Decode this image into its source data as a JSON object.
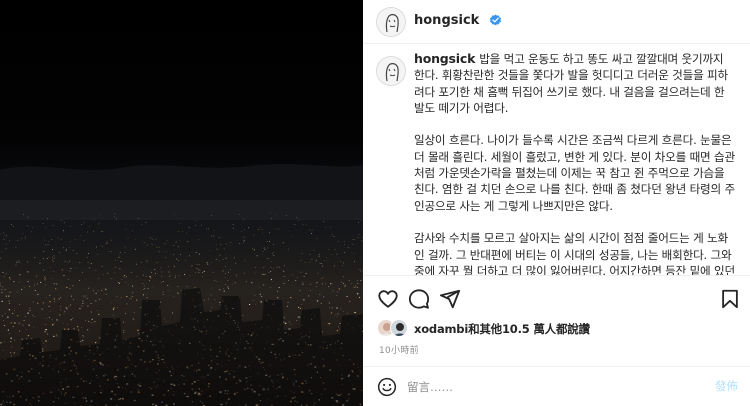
{
  "post": {
    "username": "hongsick",
    "verified_icon": "verified-badge-icon",
    "caption": [
      "밥을 먹고 운동도 하고 똥도 싸고 깔깔대며 웃기까지 한다. 휘황찬란한 것들을 쫓다가 발을 헛디디고 더러운 것들을 피하려다 포기한 채 흠뻑 뒤집어 쓰기로 했다. 내 걸음을 걸으려는데 한 발도 떼기가 어렵다.",
      "일상이 흐른다. 나이가 들수록 시간은 조금씩 다르게 흐른다. 눈물은 더 몰래 흘린다. 세월이 흘렀고, 변한 게 있다. 분이 차오를 때면 습관처럼 가운뎃손가락을 펼쳤는데 이제는 꾹 참고 쥔 주먹으로 가슴을 친다. 염한 걸 치던 손으로 나를 친다. 한때 좀 쳤다던 왕년 타령의 주인공으로 사는 게 그렇게 나쁘지만은 않다.",
      "감사와 수치를 모르고 살아지는 삶의 시간이 점점 줄어드는 게 노화인 걸까. 그 반대편에 버티는 이 시대의 성공들, 나는 배회한다. 그와중에 자꾸 뭘 더하고 더 많이 잃어버린다. 어지간하면 등잔 밑에 있던 것들이 더는 보이지 않고 동전 먹은 자판기에 그러듯 마구 잡이로 치고 두드린다."
    ],
    "likes_text": "xodambi和其他10.5 萬人都說讚",
    "timestamp": "10小時前"
  },
  "actions": {
    "like": "heart-icon",
    "comment": "comment-icon",
    "share": "share-icon",
    "save": "bookmark-icon"
  },
  "composer": {
    "placeholder": "留言……",
    "post_label": "發佈",
    "emoji": "emoji-icon"
  },
  "colors": {
    "verified": "#3897f0",
    "post_button": "#b2dffc",
    "muted": "#8e8e8e"
  }
}
